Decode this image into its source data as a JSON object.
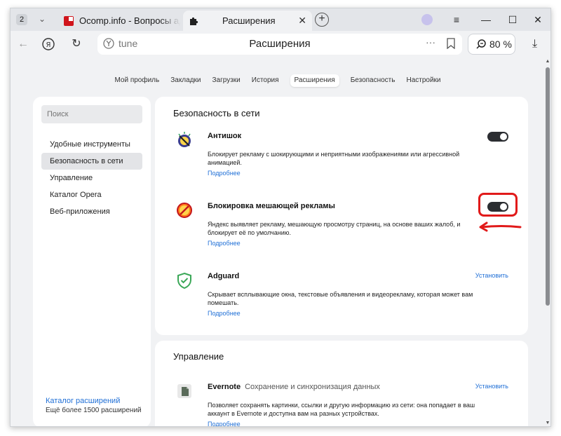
{
  "browser": {
    "tab_count": "2",
    "tabs": [
      {
        "title": "Ocomp.info - Вопросы адм",
        "active": false
      },
      {
        "title": "Расширения",
        "active": true
      }
    ],
    "site_label": "tune",
    "page_title": "Расширения",
    "zoom": "80 %"
  },
  "nav": {
    "links": [
      "Мой профиль",
      "Закладки",
      "Загрузки",
      "История",
      "Расширения",
      "Безопасность",
      "Настройки"
    ],
    "active": "Расширения"
  },
  "sidebar": {
    "search_placeholder": "Поиск",
    "items": [
      {
        "label": "Удобные инструменты",
        "selected": false
      },
      {
        "label": "Безопасность в сети",
        "selected": true
      },
      {
        "label": "Управление",
        "selected": false
      },
      {
        "label": "Каталог Opera",
        "selected": false
      },
      {
        "label": "Веб-приложения",
        "selected": false
      }
    ],
    "footer_link": "Каталог расширений",
    "footer_sub": "Ещё более 1500 расширений"
  },
  "sections": {
    "security": {
      "title": "Безопасность в сети",
      "extensions": [
        {
          "name": "Антишок",
          "description": "Блокирует рекламу с шокирующими и неприятными изображениями или агрессивной анимацией.",
          "more": "Подробнее",
          "enabled": true,
          "icon": "antishock-icon"
        },
        {
          "name": "Блокировка мешающей рекламы",
          "description": "Яндекс выявляет рекламу, мешающую просмотру страниц, на основе ваших жалоб, и блокирует её по умолчанию.",
          "more": "Подробнее",
          "enabled": true,
          "icon": "ad-block-icon"
        },
        {
          "name": "Adguard",
          "description": "Скрывает всплывающие окна, текстовые объявления и видеорекламу, которая может вам помешать.",
          "more": "Подробнее",
          "action": "Установить",
          "icon": "adguard-shield-icon"
        }
      ]
    },
    "management": {
      "title": "Управление",
      "extensions": [
        {
          "name": "Evernote",
          "tagline": "Сохранение и синхронизация данных",
          "description": "Позволяет сохранять картинки, ссылки и другую информацию из сети: она попадает в ваш аккаунт в Evernote и доступна вам на разных устройствах.",
          "more": "Подробнее",
          "action": "Установить",
          "icon": "evernote-icon"
        }
      ]
    }
  },
  "colors": {
    "link": "#1f6fd6",
    "toggle_on": "#2b2d31",
    "annotation": "#e11a1a"
  }
}
